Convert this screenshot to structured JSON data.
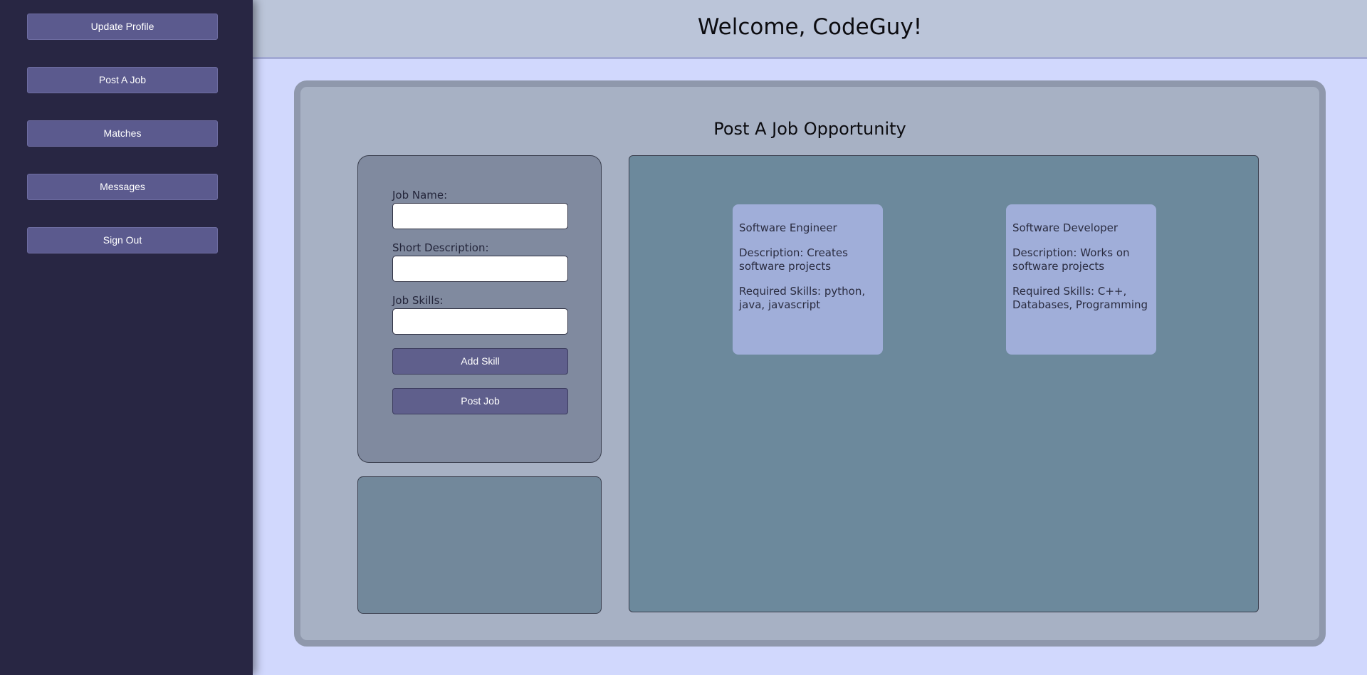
{
  "sidebar": {
    "items": [
      {
        "label": "Update Profile"
      },
      {
        "label": "Post A Job"
      },
      {
        "label": "Matches"
      },
      {
        "label": "Messages"
      },
      {
        "label": "Sign Out"
      }
    ]
  },
  "header": {
    "title": "Welcome, CodeGuy!"
  },
  "main": {
    "title": "Post A Job Opportunity",
    "form": {
      "job_name_label": "Job Name:",
      "job_name_value": "",
      "short_description_label": "Short Description:",
      "short_description_value": "",
      "job_skills_label": "Job Skills:",
      "job_skills_value": "",
      "add_skill_label": "Add Skill",
      "post_job_label": "Post Job"
    },
    "jobs": [
      {
        "name": "Software Engineer",
        "description": "Description: Creates software projects",
        "skills": "Required Skills: python, java, javascript"
      },
      {
        "name": "Software Developer",
        "description": "Description: Works on software projects",
        "skills": "Required Skills: C++, Databases, Programming"
      }
    ]
  },
  "colors": {
    "sidebar_bg": "#282643",
    "button_bg": "#5b5a8e",
    "page_bg": "#d1d8fd",
    "header_bg": "#bbc5d9",
    "panel_bg": "#a7b1c4",
    "jobs_area_bg": "#6c899c",
    "job_card_bg": "#a0aed9"
  }
}
